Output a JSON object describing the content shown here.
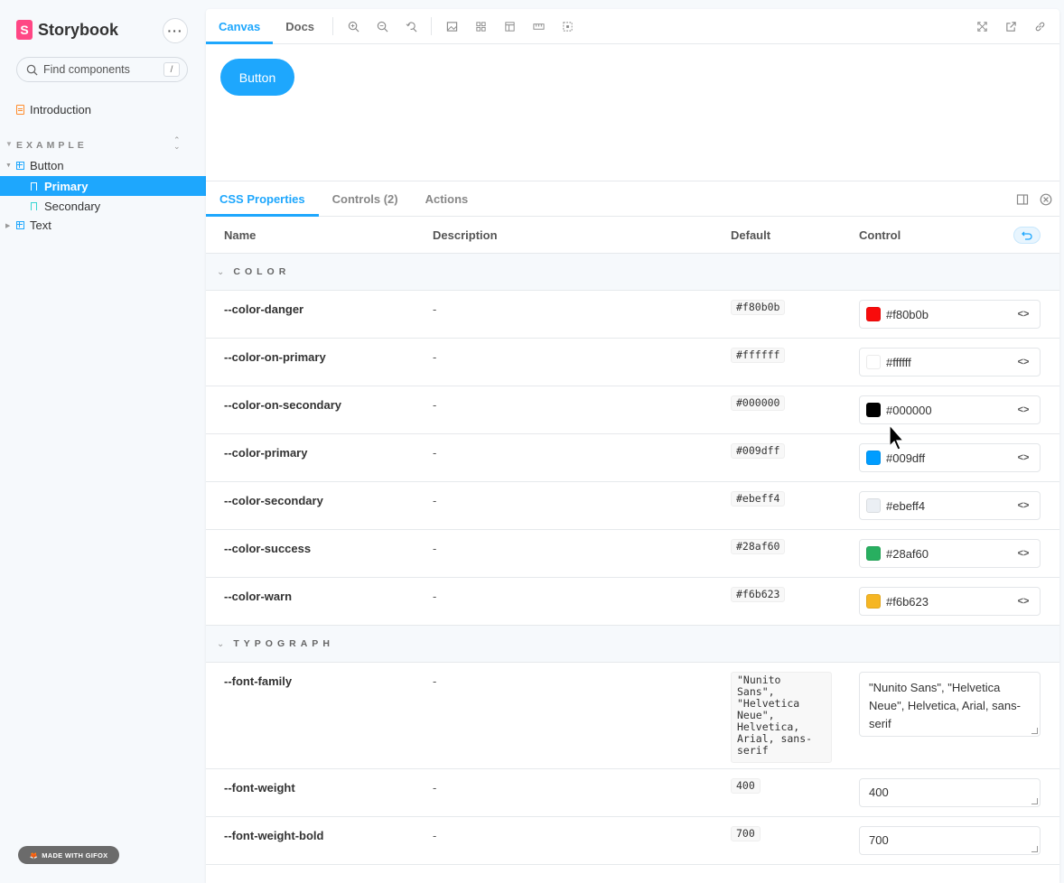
{
  "sidebar": {
    "brand": "Storybook",
    "logo_letter": "S",
    "search_placeholder": "Find components",
    "search_shortcut": "/",
    "intro": "Introduction",
    "group": "EXAMPLE",
    "button": "Button",
    "primary": "Primary",
    "secondary": "Secondary",
    "text": "Text",
    "gifox": "MADE WITH GIFOX"
  },
  "toolbar": {
    "canvas_tab": "Canvas",
    "docs_tab": "Docs"
  },
  "canvas": {
    "button_label": "Button"
  },
  "addons": {
    "tabs": [
      "CSS Properties",
      "Controls (2)",
      "Actions"
    ]
  },
  "table": {
    "headers": {
      "name": "Name",
      "description": "Description",
      "default": "Default",
      "control": "Control"
    },
    "sections": [
      {
        "label": "COLOR",
        "rows": [
          {
            "name": "--color-danger",
            "desc": "-",
            "default": "#f80b0b",
            "value": "#f80b0b",
            "swatch": "#f80b0b"
          },
          {
            "name": "--color-on-primary",
            "desc": "-",
            "default": "#ffffff",
            "value": "#ffffff",
            "swatch": "#ffffff"
          },
          {
            "name": "--color-on-secondary",
            "desc": "-",
            "default": "#000000",
            "value": "#000000",
            "swatch": "#000000"
          },
          {
            "name": "--color-primary",
            "desc": "-",
            "default": "#009dff",
            "value": "#009dff",
            "swatch": "#009dff"
          },
          {
            "name": "--color-secondary",
            "desc": "-",
            "default": "#ebeff4",
            "value": "#ebeff4",
            "swatch": "#ebeff4"
          },
          {
            "name": "--color-success",
            "desc": "-",
            "default": "#28af60",
            "value": "#28af60",
            "swatch": "#28af60"
          },
          {
            "name": "--color-warn",
            "desc": "-",
            "default": "#f6b623",
            "value": "#f6b623",
            "swatch": "#f6b623"
          }
        ]
      },
      {
        "label": "TYPOGRAPH",
        "rows": [
          {
            "name": "--font-family",
            "desc": "-",
            "default": "\"Nunito\nSans\",\n\"Helvetica\nNeue\",\nHelvetica,\nArial, sans-\nserif",
            "value": "\"Nunito Sans\", \"Helvetica Neue\", Helvetica, Arial, sans-serif"
          },
          {
            "name": "--font-weight",
            "desc": "-",
            "default": "400",
            "value": "400"
          },
          {
            "name": "--font-weight-bold",
            "desc": "-",
            "default": "700",
            "value": "700"
          }
        ]
      }
    ]
  },
  "colors": {
    "accent": "#1ea7fd",
    "pink": "#ff4785"
  },
  "icons": [
    "search-icon",
    "zoom-in-icon",
    "zoom-out-icon",
    "zoom-reset-icon",
    "image-icon",
    "grid-icon",
    "outline-icon",
    "measure-icon",
    "viewport-icon",
    "fullscreen-icon",
    "open-new-icon",
    "link-icon",
    "panel-icon",
    "close-icon",
    "reset-icon",
    "code-icon"
  ]
}
